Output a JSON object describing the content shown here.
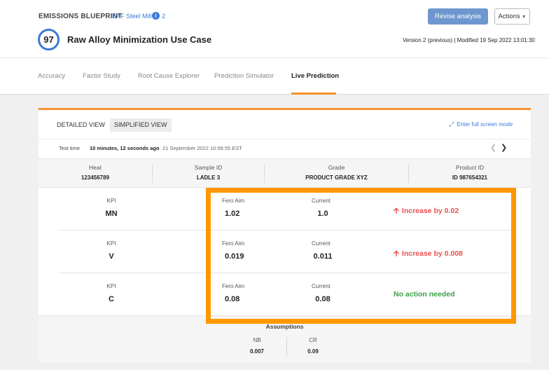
{
  "header": {
    "brand": "EMISSIONS BLUEPRINT",
    "plant": "EAF Steel Mill",
    "info_icon": "info-icon",
    "info_count": "2",
    "score": "97",
    "title": "Raw Alloy Minimization Use Case",
    "revise_label": "Revise analysis",
    "actions_label": "Actions",
    "version": "Version 2 (previous) | Modified 19 Sep 2022 13:01:30"
  },
  "tabs": [
    {
      "label": "Accuracy"
    },
    {
      "label": "Factor Study"
    },
    {
      "label": "Root Cause Explorer"
    },
    {
      "label": "Prediction Simulator"
    },
    {
      "label": "Live Prediction",
      "active": true
    }
  ],
  "view": {
    "detailed_label": "DETAILED VIEW",
    "simplified_label": "SIMPLIFIED VIEW",
    "selected": "SIMPLIFIED VIEW",
    "fullscreen_label": "Enter full screen mode",
    "fullscreen_icon": "expand-icon"
  },
  "test_time": {
    "label": "Test time",
    "value": "10 minutes, 12 seconds ago",
    "date": "21 September 2022 10:58:55 EST"
  },
  "info": [
    {
      "label": "Heat",
      "value": "123456789"
    },
    {
      "label": "Sample ID",
      "value": "LADLE 3"
    },
    {
      "label": "Grade",
      "value": "PRODUCT GRADE XYZ"
    },
    {
      "label": "Product ID",
      "value": "ID 987654321"
    }
  ],
  "kpis": [
    {
      "kpi_label": "KPI",
      "kpi": "MN",
      "aim_label": "Fero Aim",
      "aim": "1.02",
      "current_label": "Current",
      "current": "1.0",
      "action": "Increase by 0.02",
      "status": "up"
    },
    {
      "kpi_label": "KPI",
      "kpi": "V",
      "aim_label": "Fero Aim",
      "aim": "0.019",
      "current_label": "Current",
      "current": "0.011",
      "action": "Increase by 0.008",
      "status": "up"
    },
    {
      "kpi_label": "KPI",
      "kpi": "C",
      "aim_label": "Fero Aim",
      "aim": "0.08",
      "current_label": "Current",
      "current": "0.08",
      "action": "No action needed",
      "status": "ok"
    }
  ],
  "assumptions": {
    "title": "Assumptions",
    "items": [
      {
        "label": "NB",
        "value": "0.007"
      },
      {
        "label": "CR",
        "value": "0.09"
      }
    ]
  },
  "colors": {
    "accent": "#f7912d",
    "primary_blue": "#3a7bd5",
    "increase_red": "#e8504f",
    "ok_green": "#3d9e4a",
    "highlight_orange": "#ff9800"
  }
}
